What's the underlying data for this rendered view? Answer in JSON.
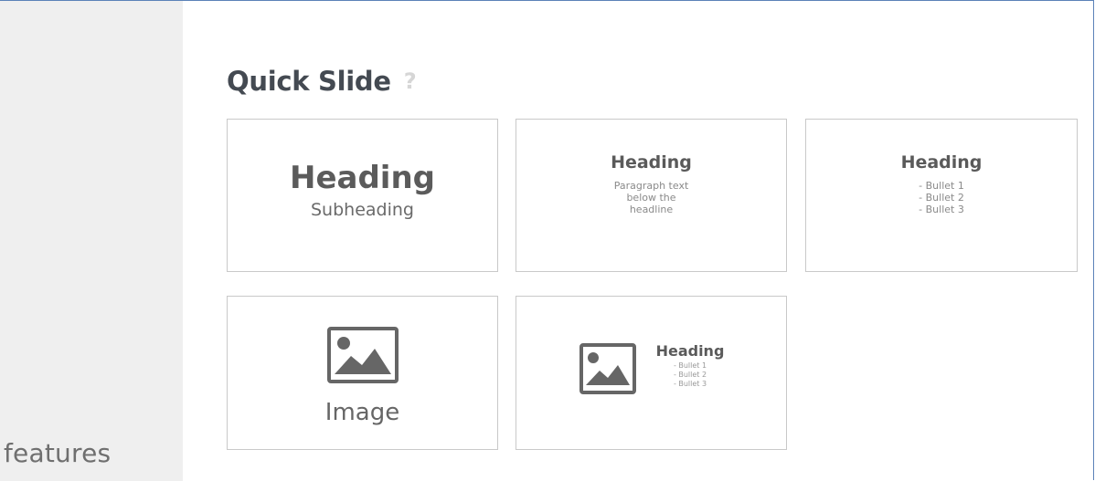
{
  "sidebar": {
    "label": "features"
  },
  "panel": {
    "title": "Quick Slide",
    "help": "?"
  },
  "cards": {
    "title_sub": {
      "heading": "Heading",
      "subheading": "Subheading"
    },
    "title_paragraph": {
      "heading": "Heading",
      "lines": [
        "Paragraph text",
        "below the",
        "headline"
      ]
    },
    "title_bullets": {
      "heading": "Heading",
      "lines": [
        "- Bullet 1",
        "- Bullet 2",
        "- Bullet 3"
      ]
    },
    "image": {
      "label": "Image",
      "icon": "image-icon"
    },
    "image_bullets": {
      "heading": "Heading",
      "lines": [
        "- Bullet 1",
        "- Bullet 2",
        "- Bullet 3"
      ],
      "icon": "image-icon"
    }
  }
}
